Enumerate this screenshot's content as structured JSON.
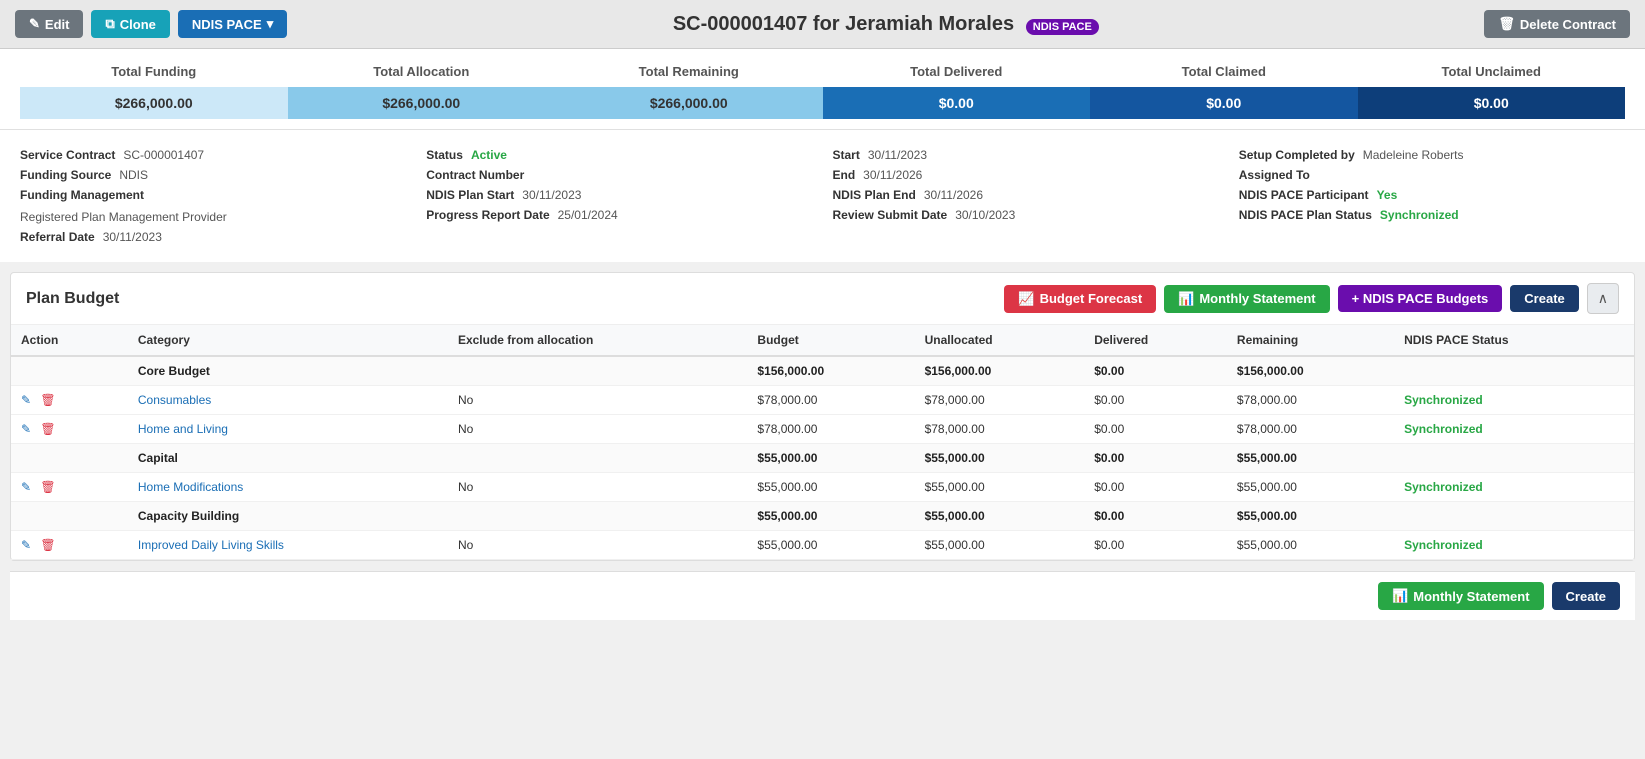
{
  "header": {
    "title": "SC-000001407 for Jeramiah Morales",
    "badge": "NDIS PACE",
    "edit_label": "Edit",
    "clone_label": "Clone",
    "ndis_pace_label": "NDIS PACE",
    "delete_label": "Delete Contract"
  },
  "summary": {
    "headers": [
      "Total Funding",
      "Total Allocation",
      "Total Remaining",
      "Total Delivered",
      "Total Claimed",
      "Total Unclaimed"
    ],
    "values": [
      "$266,000.00",
      "$266,000.00",
      "$266,000.00",
      "$0.00",
      "$0.00",
      "$0.00"
    ]
  },
  "info": {
    "service_contract_label": "Service Contract",
    "service_contract_value": "SC-000001407",
    "status_label": "Status",
    "status_value": "Active",
    "start_label": "Start",
    "start_value": "30/11/2023",
    "setup_completed_label": "Setup Completed by",
    "setup_completed_value": "Madeleine Roberts",
    "funding_source_label": "Funding Source",
    "funding_source_value": "NDIS",
    "contract_number_label": "Contract Number",
    "contract_number_value": "",
    "end_label": "End",
    "end_value": "30/11/2026",
    "assigned_to_label": "Assigned To",
    "assigned_to_value": "",
    "funding_management_label": "Funding Management",
    "funding_management_value": "Registered Plan Management Provider",
    "ndis_plan_start_label": "NDIS Plan Start",
    "ndis_plan_start_value": "30/11/2023",
    "ndis_plan_end_label": "NDIS Plan End",
    "ndis_plan_end_value": "30/11/2026",
    "ndis_pace_participant_label": "NDIS PACE Participant",
    "ndis_pace_participant_value": "Yes",
    "referral_date_label": "Referral Date",
    "referral_date_value": "30/11/2023",
    "progress_report_label": "Progress Report Date",
    "progress_report_value": "25/01/2024",
    "review_submit_label": "Review Submit Date",
    "review_submit_value": "30/10/2023",
    "ndis_pace_plan_status_label": "NDIS PACE Plan Status",
    "ndis_pace_plan_status_value": "Synchronized"
  },
  "plan_budget": {
    "title": "Plan Budget",
    "budget_forecast_label": "Budget Forecast",
    "monthly_statement_label": "Monthly Statement",
    "ndis_pace_budgets_label": "+ NDIS PACE Budgets",
    "create_label": "Create",
    "columns": [
      "Action",
      "Category",
      "Exclude from allocation",
      "Budget",
      "Unallocated",
      "Delivered",
      "Remaining",
      "NDIS PACE Status"
    ],
    "rows": [
      {
        "type": "category",
        "category": "Core Budget",
        "budget": "$156,000.00",
        "unallocated": "$156,000.00",
        "delivered": "$0.00",
        "remaining": "$156,000.00",
        "status": ""
      },
      {
        "type": "item",
        "category": "Consumables",
        "exclude": "No",
        "budget": "$78,000.00",
        "unallocated": "$78,000.00",
        "delivered": "$0.00",
        "remaining": "$78,000.00",
        "status": "Synchronized"
      },
      {
        "type": "item",
        "category": "Home and Living",
        "exclude": "No",
        "budget": "$78,000.00",
        "unallocated": "$78,000.00",
        "delivered": "$0.00",
        "remaining": "$78,000.00",
        "status": "Synchronized"
      },
      {
        "type": "category",
        "category": "Capital",
        "budget": "$55,000.00",
        "unallocated": "$55,000.00",
        "delivered": "$0.00",
        "remaining": "$55,000.00",
        "status": ""
      },
      {
        "type": "item",
        "category": "Home Modifications",
        "exclude": "No",
        "budget": "$55,000.00",
        "unallocated": "$55,000.00",
        "delivered": "$0.00",
        "remaining": "$55,000.00",
        "status": "Synchronized"
      },
      {
        "type": "category",
        "category": "Capacity Building",
        "budget": "$55,000.00",
        "unallocated": "$55,000.00",
        "delivered": "$0.00",
        "remaining": "$55,000.00",
        "status": ""
      },
      {
        "type": "item",
        "category": "Improved Daily Living Skills",
        "exclude": "No",
        "budget": "$55,000.00",
        "unallocated": "$55,000.00",
        "delivered": "$0.00",
        "remaining": "$55,000.00",
        "status": "Synchronized"
      }
    ]
  },
  "bottom_buttons": {
    "monthly_statement_label": "Monthly Statement",
    "create_label": "Create"
  }
}
